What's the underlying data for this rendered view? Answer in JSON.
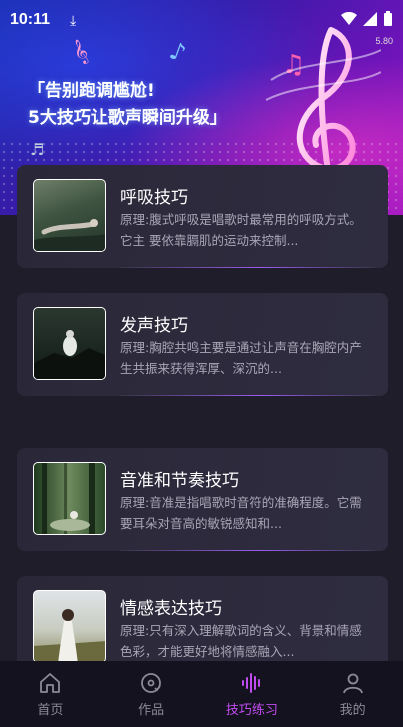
{
  "status_bar": {
    "time": "10:11",
    "speed": "5.80"
  },
  "banner": {
    "line1": "「告别跑调尴尬!",
    "line2": "5大技巧让歌声瞬间升级」"
  },
  "cards": [
    {
      "title": "呼吸技巧",
      "desc": "原理:腹式呼吸是唱歌时最常用的呼吸方式。它主 要依靠膈肌的运动来控制...",
      "thumb_colors": [
        "#2b3a2e",
        "#5a6e58",
        "#9aa89a"
      ]
    },
    {
      "title": "发声技巧",
      "desc": "原理:胸腔共鸣主要是通过让声音在胸腔内产生共振来获得浑厚、深沉的...",
      "thumb_colors": [
        "#1c2420",
        "#3c4a40",
        "#d8dcd8"
      ]
    },
    {
      "title": "音准和节奏技巧",
      "desc": "原理:音准是指唱歌时音符的准确程度。它需要耳朵对音高的敏锐感知和...",
      "thumb_colors": [
        "#2e4a2a",
        "#6e8a5a",
        "#b8c8a8"
      ]
    },
    {
      "title": "情感表达技巧",
      "desc": "原理:只有深入理解歌词的含义、背景和情感色彩，才能更好地将情感融入...",
      "thumb_colors": [
        "#c8d0d8",
        "#8a8a70",
        "#5a5a3a"
      ]
    }
  ],
  "tabbar": {
    "tabs": [
      {
        "label": "首页",
        "icon": "home-icon",
        "active": false
      },
      {
        "label": "作品",
        "icon": "works-icon",
        "active": false
      },
      {
        "label": "技巧练习",
        "icon": "sound-wave-icon",
        "active": true
      },
      {
        "label": "我的",
        "icon": "person-icon",
        "active": false
      }
    ],
    "active_color": "#c04cf0",
    "inactive_color": "#8c8a98"
  }
}
